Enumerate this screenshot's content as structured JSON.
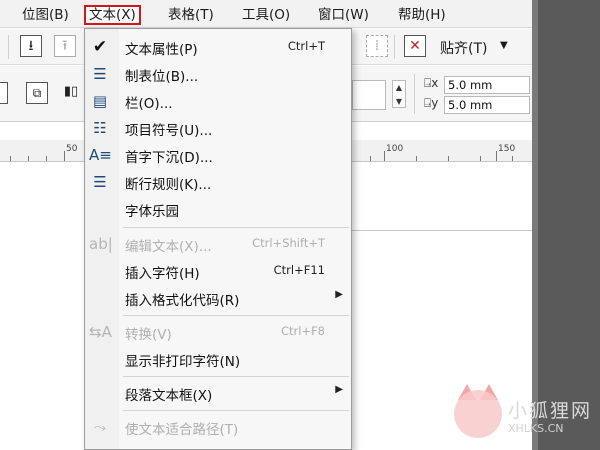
{
  "menubar": {
    "items": [
      {
        "label": "位图(B)"
      },
      {
        "label": "文本(X)"
      },
      {
        "label": "表格(T)"
      },
      {
        "label": "工具(O)"
      },
      {
        "label": "窗口(W)"
      },
      {
        "label": "帮助(H)"
      }
    ]
  },
  "toolbar": {
    "align_label": "贴齐(T)",
    "offset_x": "5.0 mm",
    "offset_y": "5.0 mm"
  },
  "ruler": {
    "labels": [
      "50",
      "100",
      "150"
    ]
  },
  "text_menu": {
    "items": [
      {
        "label": "文本属性(P)",
        "shortcut": "Ctrl+T"
      },
      {
        "label": "制表位(B)..."
      },
      {
        "label": "栏(O)..."
      },
      {
        "label": "项目符号(U)..."
      },
      {
        "label": "首字下沉(D)..."
      },
      {
        "label": "断行规则(K)..."
      },
      {
        "label": "字体乐园"
      },
      {
        "label": "编辑文本(X)...",
        "shortcut": "Ctrl+Shift+T"
      },
      {
        "label": "插入字符(H)",
        "shortcut": "Ctrl+F11"
      },
      {
        "label": "插入格式化代码(R)"
      },
      {
        "label": "转换(V)",
        "shortcut": "Ctrl+F8"
      },
      {
        "label": "显示非打印字符(N)"
      },
      {
        "label": "段落文本框(X)"
      },
      {
        "label": "使文本适合路径(T)"
      }
    ]
  },
  "watermark": {
    "name": "小狐狸网",
    "url": "XHLKS.CN"
  },
  "colors": {
    "highlight_border": "#d01818",
    "menu_bg": "#f7f7f7",
    "right_panel": "#5a5a5a"
  }
}
